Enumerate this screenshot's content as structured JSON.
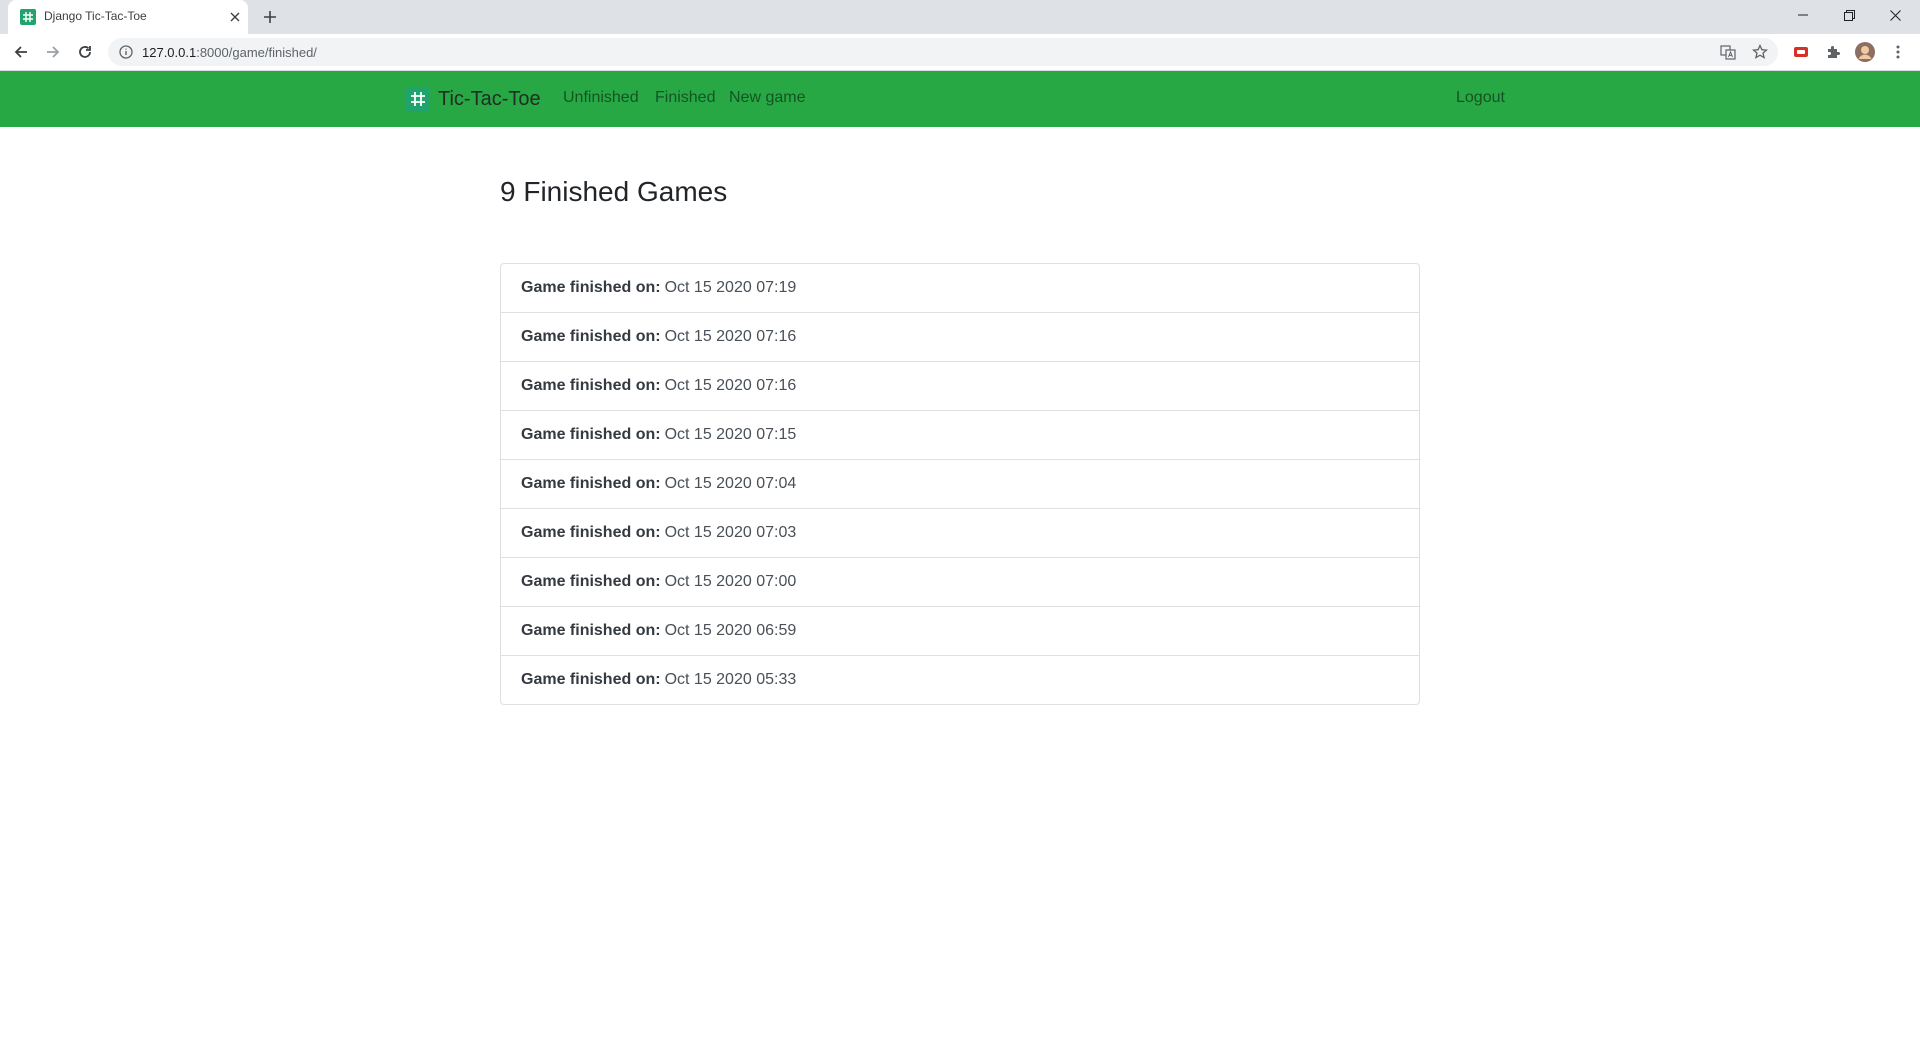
{
  "browser": {
    "tab_title": "Django Tic-Tac-Toe",
    "url_host": "127.0.0.1",
    "url_rest": ":8000/game/finished/"
  },
  "navbar": {
    "brand": "Tic-Tac-Toe",
    "links": [
      "Unfinished",
      "Finished",
      "New game"
    ],
    "logout": "Logout"
  },
  "main": {
    "title": "9 Finished Games",
    "item_label": "Game finished on:",
    "games": [
      "Oct 15 2020 07:19",
      "Oct 15 2020 07:16",
      "Oct 15 2020 07:16",
      "Oct 15 2020 07:15",
      "Oct 15 2020 07:04",
      "Oct 15 2020 07:03",
      "Oct 15 2020 07:00",
      "Oct 15 2020 06:59",
      "Oct 15 2020 05:33"
    ]
  },
  "colors": {
    "navbar": "#28a745",
    "favicon": "#20a36c"
  }
}
